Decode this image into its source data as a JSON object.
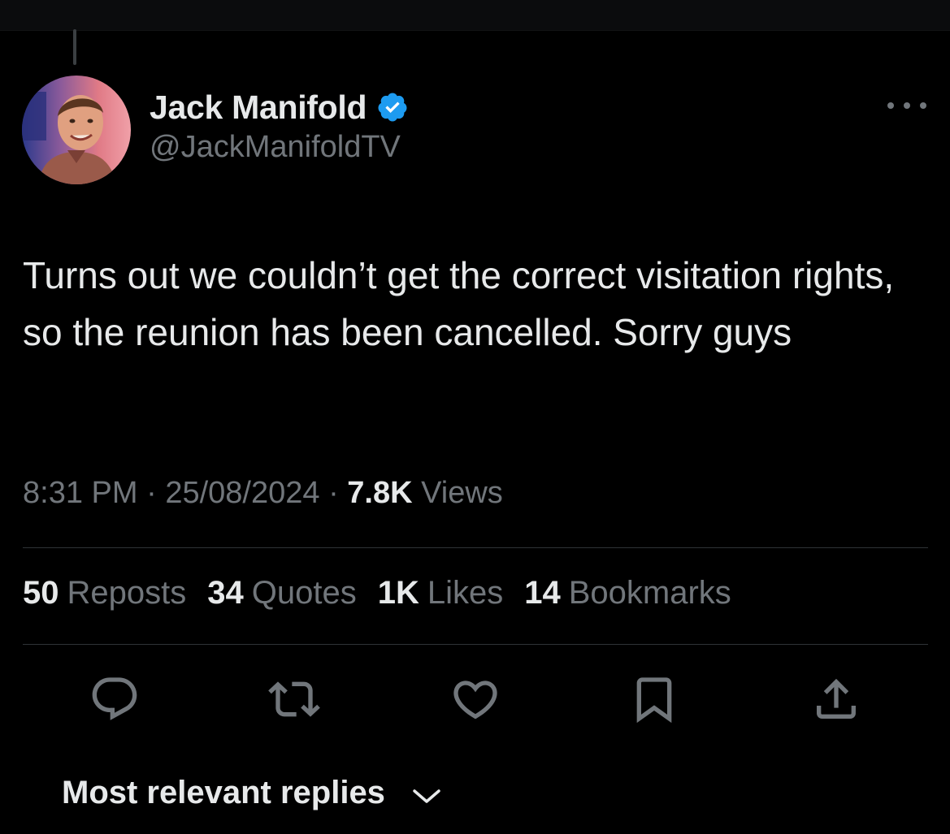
{
  "tweet": {
    "author": {
      "display_name": "Jack Manifold",
      "handle": "@JackManifoldTV",
      "verified": true,
      "verified_color": "#1d9bf0"
    },
    "text": "Turns out we couldn’t get the correct visitation rights, so the reunion has been cancelled. Sorry guys",
    "time": "8:31 PM",
    "date": "25/08/2024",
    "separator": "·",
    "views_count": "7.8K",
    "views_label": "Views"
  },
  "stats": [
    {
      "count": "50",
      "label": "Reposts"
    },
    {
      "count": "34",
      "label": "Quotes"
    },
    {
      "count": "1K",
      "label": "Likes"
    },
    {
      "count": "14",
      "label": "Bookmarks"
    }
  ],
  "actions": [
    {
      "icon": "reply-icon"
    },
    {
      "icon": "repost-icon"
    },
    {
      "icon": "like-icon"
    },
    {
      "icon": "bookmark-icon"
    },
    {
      "icon": "share-icon"
    }
  ],
  "replies": {
    "sort_label": "Most relevant replies"
  },
  "colors": {
    "background": "#000000",
    "primary_text": "#e7e9ea",
    "secondary_text": "#71767b",
    "divider": "#2f3336"
  }
}
